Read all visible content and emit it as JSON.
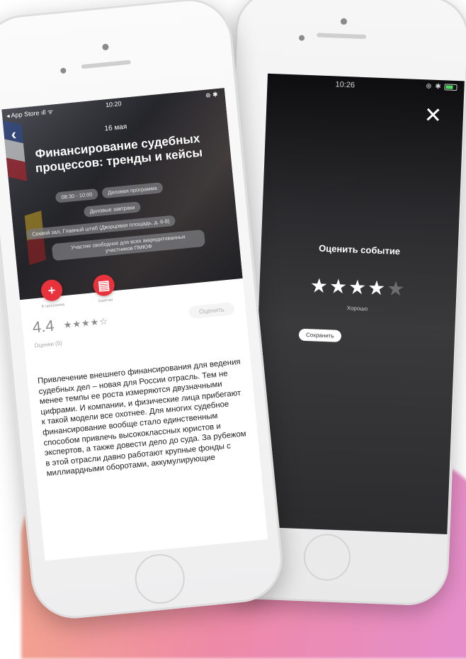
{
  "back_phone": {
    "status": {
      "time": "10:26",
      "right": "⊛ ✱"
    },
    "close_label": "✕",
    "rate_title": "Оценить событие",
    "rating": {
      "value": 4,
      "max": 5,
      "word": "Хорошо"
    },
    "save_label": "Сохранить"
  },
  "front_phone": {
    "status": {
      "left": "◂ App Store ıll ᯤ",
      "time": "10:20",
      "right": "⊛ ✱"
    },
    "back_label": "‹",
    "event": {
      "date": "16 мая",
      "title": "Финансирование судебных процессов: тренды и кейсы",
      "chips": [
        "08:30 - 10:00",
        "Деловая программа",
        "Деловые завтраки",
        "Секвой зал, Главный штаб (Дворцовая площадь, д. 6-8)",
        "Участие свободное для всех аккредитованных участников ПМЮФ"
      ]
    },
    "actions": [
      {
        "icon": "+",
        "label": "В программу"
      },
      {
        "icon": "▤",
        "label": "Заметки"
      }
    ],
    "rating": {
      "value": "4.4",
      "stars": "★★★★☆",
      "rate_label": "Оценить",
      "reviews": "Оценки (5)"
    },
    "description": "Привлечение внешнего финансирования для ведения судебных дел – новая для России отрасль. Тем не менее темпы ее роста измеряются двузначными цифрами. И компании, и физические лица прибегают к такой модели все охотнее. Для многих судебное финансирование вообще стало единственным способом привлечь высококлассных юристов и экспертов, а также довести дело до суда. За рубежом в этой отрасли давно работают крупные фонды с миллиардными оборотами, аккумулирующие"
  },
  "colors": {
    "accent": "#e8323c",
    "background_gradient": [
      "#f3a58c",
      "#ee8aa6",
      "#e58fcf"
    ]
  }
}
